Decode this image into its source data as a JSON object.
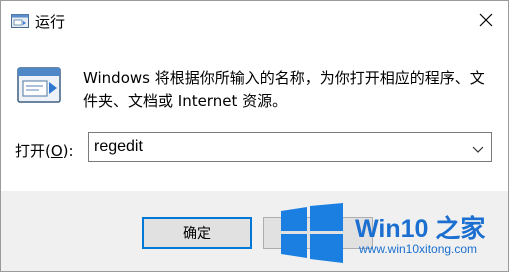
{
  "window": {
    "title": "运行",
    "close_icon": "close-icon"
  },
  "content": {
    "description": "Windows 将根据你所输入的名称，为你打开相应的程序、文件夹、文档或 Internet 资源。"
  },
  "open": {
    "label_prefix": "打开(",
    "label_hotkey": "O",
    "label_suffix": "):",
    "value": "regedit"
  },
  "buttons": {
    "ok_label": "确定"
  },
  "watermark": {
    "title": "Win10 之家",
    "url": "www.win10xitong.com"
  },
  "colors": {
    "accent": "#0078d7",
    "watermark_blue": "#1a6fd0"
  }
}
